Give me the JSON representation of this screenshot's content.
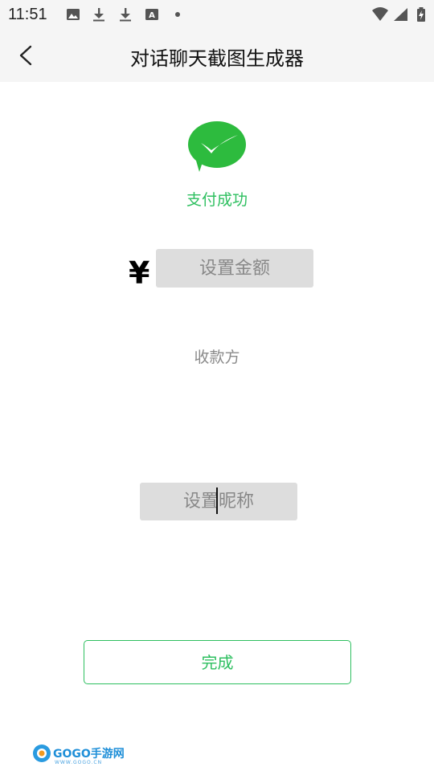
{
  "status_bar": {
    "time": "11:51",
    "left_icons": [
      "image-icon",
      "download-icon",
      "download-icon",
      "a-icon",
      "dot-icon"
    ],
    "right_icons": [
      "wifi-icon",
      "signal-icon",
      "battery-icon"
    ]
  },
  "app_bar": {
    "title": "对话聊天截图生成器",
    "back_icon": "chevron-left-icon"
  },
  "payment": {
    "logo_icon": "wechat-pay-logo-icon",
    "status_text": "支付成功",
    "currency_symbol": "¥",
    "amount_placeholder": "设置金额",
    "amount_value": "",
    "receiver_label": "收款方",
    "nickname_placeholder": "设置昵称",
    "nickname_value": ""
  },
  "actions": {
    "done_label": "完成"
  },
  "watermark": {
    "brand": "GOGO手游网",
    "sub": "WWW.GOGO.CN"
  },
  "colors": {
    "accent": "#2dbf5f",
    "bar_bg": "#f5f5f5",
    "field_bg": "#dddddd"
  }
}
